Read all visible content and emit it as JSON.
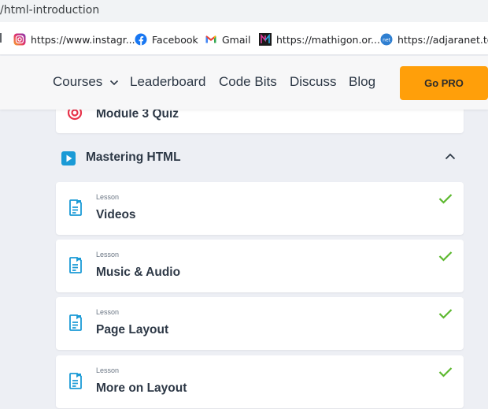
{
  "browser": {
    "url_fragment": "/html-introduction",
    "bookmarks": [
      {
        "label": "https://www.instagr...",
        "icon": "instagram-icon"
      },
      {
        "label": "Facebook",
        "icon": "facebook-icon"
      },
      {
        "label": "Gmail",
        "icon": "gmail-icon"
      },
      {
        "label": "https://mathigon.or...",
        "icon": "mathigon-icon"
      },
      {
        "label": "https://adjaranet.to/",
        "icon": "adjaranet-icon"
      }
    ]
  },
  "nav": {
    "courses": "Courses",
    "leaderboard": "Leaderboard",
    "code_bits": "Code Bits",
    "discuss": "Discuss",
    "blog": "Blog",
    "go_pro": "Go PRO"
  },
  "quiz": {
    "title": "Module 3 Quiz"
  },
  "section": {
    "title": "Mastering HTML"
  },
  "lessons": [
    {
      "kind": "Lesson",
      "title": "Videos",
      "completed": true
    },
    {
      "kind": "Lesson",
      "title": "Music & Audio",
      "completed": true
    },
    {
      "kind": "Lesson",
      "title": "Page Layout",
      "completed": true
    },
    {
      "kind": "Lesson",
      "title": "More on Layout",
      "completed": true
    }
  ],
  "colors": {
    "accent_orange": "#ff9f0a",
    "check_green": "#5cb82e",
    "lesson_icon_blue": "#1a9ad6",
    "quiz_icon_red": "#e8334a"
  }
}
